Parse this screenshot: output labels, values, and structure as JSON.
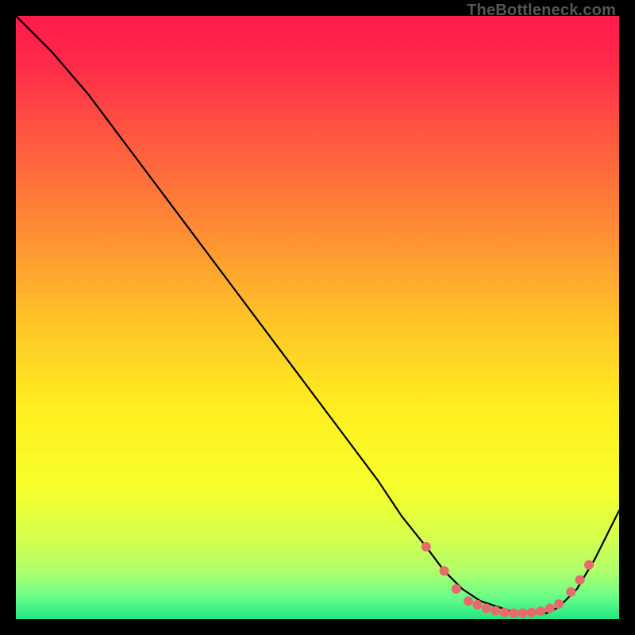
{
  "watermark": "TheBottleneck.com",
  "chart_data": {
    "type": "line",
    "title": "",
    "xlabel": "",
    "ylabel": "",
    "xlim": [
      0,
      100
    ],
    "ylim": [
      0,
      100
    ],
    "background_gradient": {
      "stops": [
        {
          "offset": 0.0,
          "color": "#ff1a4d"
        },
        {
          "offset": 0.08,
          "color": "#ff2a49"
        },
        {
          "offset": 0.2,
          "color": "#ff5840"
        },
        {
          "offset": 0.35,
          "color": "#ff8a35"
        },
        {
          "offset": 0.5,
          "color": "#ffc228"
        },
        {
          "offset": 0.65,
          "color": "#ffee20"
        },
        {
          "offset": 0.78,
          "color": "#f7ff2a"
        },
        {
          "offset": 0.86,
          "color": "#d8ff4a"
        },
        {
          "offset": 0.92,
          "color": "#b0ff6a"
        },
        {
          "offset": 0.96,
          "color": "#70ff88"
        },
        {
          "offset": 1.0,
          "color": "#20e884"
        }
      ]
    },
    "series": [
      {
        "name": "bottleneck-curve",
        "color": "#000000",
        "x": [
          0,
          6,
          12,
          18,
          24,
          30,
          36,
          42,
          48,
          54,
          60,
          64,
          68,
          71,
          74,
          77,
          80,
          83,
          86,
          88,
          90,
          93,
          96,
          100
        ],
        "y": [
          100,
          94,
          87,
          79,
          71,
          63,
          55,
          47,
          39,
          31,
          23,
          17,
          12,
          8,
          5,
          3,
          2,
          1,
          1,
          1,
          2,
          5,
          10,
          18
        ]
      }
    ],
    "markers": {
      "name": "optimal-zone-dots",
      "color": "#e86a6a",
      "radius": 6,
      "points": [
        {
          "x": 68,
          "y": 12
        },
        {
          "x": 71,
          "y": 8
        },
        {
          "x": 73,
          "y": 5
        },
        {
          "x": 75,
          "y": 3
        },
        {
          "x": 76.5,
          "y": 2.4
        },
        {
          "x": 78,
          "y": 1.8
        },
        {
          "x": 79.5,
          "y": 1.4
        },
        {
          "x": 81,
          "y": 1.1
        },
        {
          "x": 82.5,
          "y": 1.0
        },
        {
          "x": 84,
          "y": 1.0
        },
        {
          "x": 85.5,
          "y": 1.1
        },
        {
          "x": 87,
          "y": 1.3
        },
        {
          "x": 88.5,
          "y": 1.8
        },
        {
          "x": 90,
          "y": 2.5
        },
        {
          "x": 92,
          "y": 4.5
        },
        {
          "x": 93.5,
          "y": 6.5
        },
        {
          "x": 95,
          "y": 9
        }
      ]
    }
  }
}
